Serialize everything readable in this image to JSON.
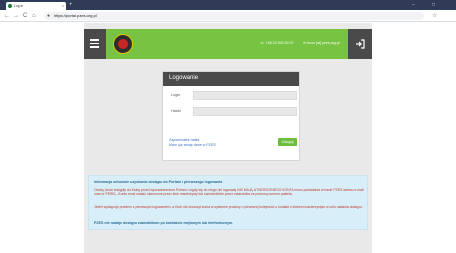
{
  "browser": {
    "tab_title": "Log in",
    "tab_close": "×",
    "new_tab": "+",
    "minimize": "–",
    "maximize": "□",
    "url": "https://portal.pzes.org.pl",
    "back": "←",
    "forward": "→",
    "reload": "C",
    "home": "⌂",
    "star": "☆",
    "lock": "🔒"
  },
  "header": {
    "phone": "☏ +48 22 000 00 07",
    "email": "✉ biuro [at] pzes.org.pl"
  },
  "login": {
    "title": "Logowanie",
    "login_label": "Login",
    "password_label": "Hasło",
    "forgot_password": "Zapomniałeś hasła",
    "no_password": "Mam już swoje dane w PZES",
    "submit": "Zaloguj"
  },
  "info": {
    "heading": "Informacja odnośnie uzyskania dostępu do Portalu i pierwszego logowania",
    "p1": "Osoby, które wstąpiły do Kluby przed wprowadzeniem Portalu i nigdy się do niego nie logowały NIE MAJĄ UTWORZONEGO KONTA mimo posiadania w bazie PZES adresu e-mail oraz nr PESEL. Konto musi zostać utworzone przez kluk macierzysty lub samodzielnie przez zawodnika za pomocą numeru patentu.",
    "p2": "Jeżeli występuje problem z pierwszym logowaniem, a Klub nie utworzył konta w systemie prosimy o pierwszej kolejności o kontakt z klubem macierzystym w celu nadania dostępu.",
    "footer": "PZES nie nadaje dostępu zawodnikom po kontakcie mejlowym lub telefonicznym."
  }
}
